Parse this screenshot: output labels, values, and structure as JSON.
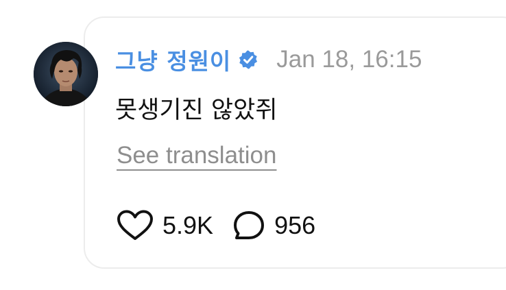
{
  "comment": {
    "author": {
      "name": "그냥 정원이",
      "verified": true,
      "verified_color": "#4a8fe2"
    },
    "timestamp": "Jan 18, 16:15",
    "text": "못생기진 않았쥐",
    "translate_label": "See translation",
    "actions": {
      "like": {
        "icon": "heart-outline-icon",
        "count": "5.9K"
      },
      "reply": {
        "icon": "speech-bubble-icon",
        "count": "956"
      }
    }
  },
  "colors": {
    "username": "#4a8fe2",
    "timestamp": "#9a9a9a",
    "text": "#111111",
    "link": "#8e8e8e",
    "card_border": "#ececec"
  }
}
